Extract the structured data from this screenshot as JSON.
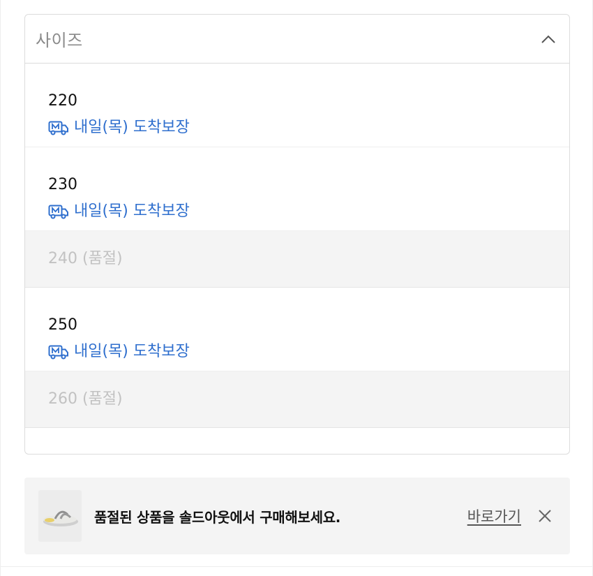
{
  "size_select": {
    "label": "사이즈",
    "expanded": true
  },
  "options": [
    {
      "size": "220",
      "delivery": "내일(목) 도착보장",
      "soldout": false
    },
    {
      "size": "230",
      "delivery": "내일(목) 도착보장",
      "soldout": false
    },
    {
      "size": "240 (품절)",
      "soldout": true
    },
    {
      "size": "250",
      "delivery": "내일(목) 도착보장",
      "soldout": false
    },
    {
      "size": "260 (품절)",
      "soldout": true
    }
  ],
  "banner": {
    "message": "품절된 상품을 솔드아웃에서 구매해보세요.",
    "link_label": "바로가기",
    "thumbnail_icon": "flip-flop-sandal"
  },
  "icons": {
    "delivery": "truck-m-icon",
    "toggle": "chevron-up-icon",
    "close": "close-icon"
  },
  "colors": {
    "delivery_blue": "#2f6fce",
    "soldout_bg": "#f4f4f4",
    "soldout_text": "#c2c2c2"
  }
}
